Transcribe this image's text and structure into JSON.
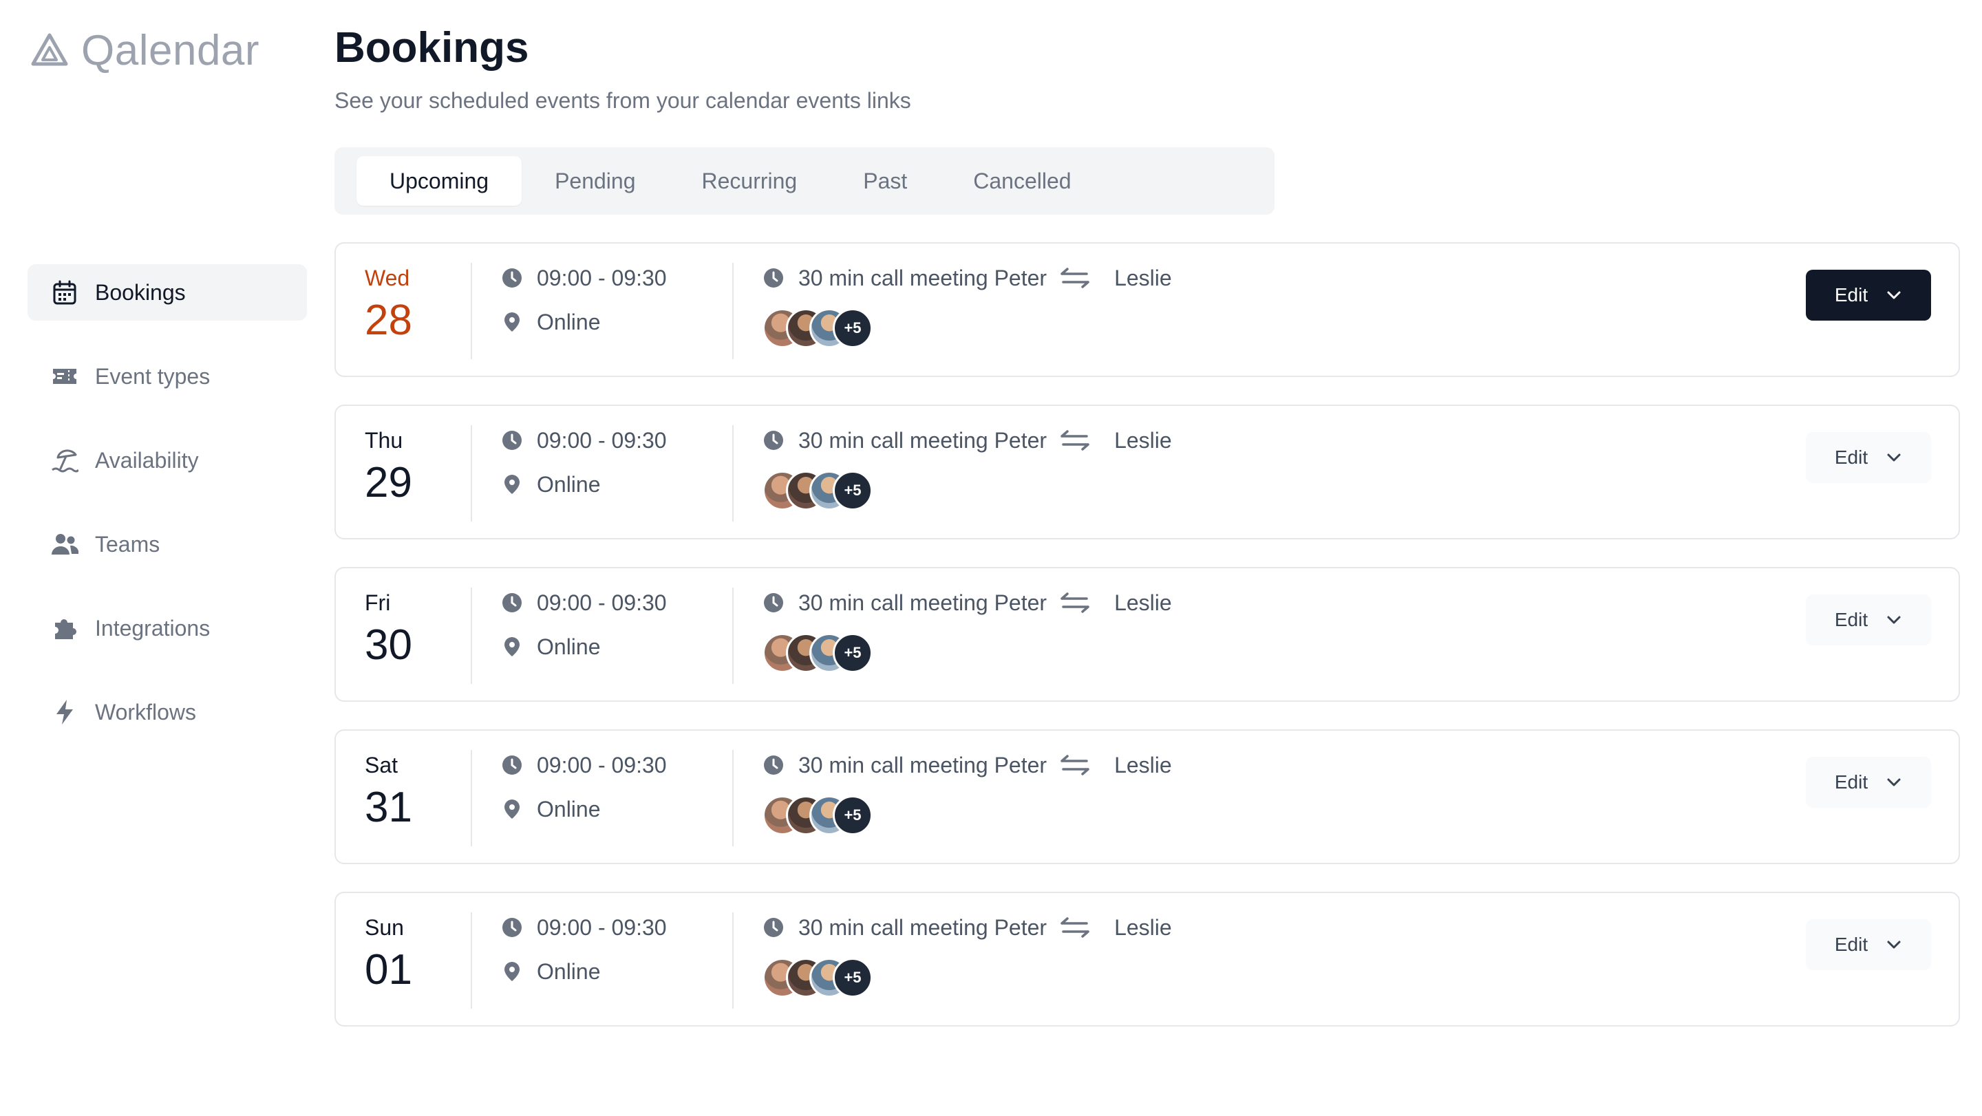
{
  "app": {
    "logo_text": "Qalendar"
  },
  "sidebar": {
    "items": [
      {
        "label": "Bookings",
        "icon": "calendar-icon",
        "active": true
      },
      {
        "label": "Event types",
        "icon": "ticket-icon"
      },
      {
        "label": "Availability",
        "icon": "beach-umbrella-icon"
      },
      {
        "label": "Teams",
        "icon": "users-icon"
      },
      {
        "label": "Integrations",
        "icon": "puzzle-icon"
      },
      {
        "label": "Workflows",
        "icon": "lightning-icon"
      }
    ]
  },
  "header": {
    "title": "Bookings",
    "subtitle": "See your scheduled events from your calendar events links"
  },
  "tabs": [
    {
      "label": "Upcoming",
      "active": true
    },
    {
      "label": "Pending"
    },
    {
      "label": "Recurring"
    },
    {
      "label": "Past"
    },
    {
      "label": "Cancelled"
    }
  ],
  "colors": {
    "today_accent": "#c2410c",
    "primary_button": "#111827"
  },
  "bookings": [
    {
      "day": "Wed",
      "date": "28",
      "time": "09:00 - 09:30",
      "location": "Online",
      "title": "30 min call meeting Peter",
      "with": "Leslie",
      "more_count": "+5",
      "edit_label": "Edit",
      "highlight": true
    },
    {
      "day": "Thu",
      "date": "29",
      "time": "09:00 - 09:30",
      "location": "Online",
      "title": "30 min call meeting Peter",
      "with": "Leslie",
      "more_count": "+5",
      "edit_label": "Edit"
    },
    {
      "day": "Fri",
      "date": "30",
      "time": "09:00 - 09:30",
      "location": "Online",
      "title": "30 min call meeting Peter",
      "with": "Leslie",
      "more_count": "+5",
      "edit_label": "Edit"
    },
    {
      "day": "Sat",
      "date": "31",
      "time": "09:00 - 09:30",
      "location": "Online",
      "title": "30 min call meeting Peter",
      "with": "Leslie",
      "more_count": "+5",
      "edit_label": "Edit"
    },
    {
      "day": "Sun",
      "date": "01",
      "time": "09:00 - 09:30",
      "location": "Online",
      "title": "30 min call meeting Peter",
      "with": "Leslie",
      "more_count": "+5",
      "edit_label": "Edit"
    }
  ]
}
